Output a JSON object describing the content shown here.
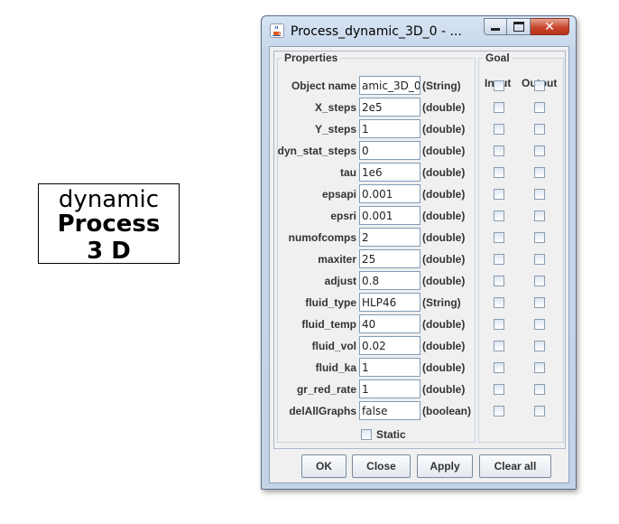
{
  "block": {
    "line1": "dynamic",
    "line2": "Process",
    "line3": "3 D"
  },
  "window": {
    "title": "Process_dynamic_3D_0 - ...",
    "icon": "java-cup-icon",
    "controls": {
      "minimize": "minimize-icon",
      "maximize": "maximize-icon",
      "close": "close-icon"
    }
  },
  "properties": {
    "legend": "Properties",
    "rows": [
      {
        "name": "Object name",
        "value": "amic_3D_0",
        "type": "(String)"
      },
      {
        "name": "X_steps",
        "value": "2e5",
        "type": "(double)"
      },
      {
        "name": "Y_steps",
        "value": "1",
        "type": "(double)"
      },
      {
        "name": "dyn_stat_steps",
        "value": "0",
        "type": "(double)"
      },
      {
        "name": "tau",
        "value": "1e6",
        "type": "(double)"
      },
      {
        "name": "epsapi",
        "value": "0.001",
        "type": "(double)"
      },
      {
        "name": "epsri",
        "value": "0.001",
        "type": "(double)"
      },
      {
        "name": "numofcomps",
        "value": "2",
        "type": "(double)"
      },
      {
        "name": "maxiter",
        "value": "25",
        "type": "(double)"
      },
      {
        "name": "adjust",
        "value": "0.8",
        "type": "(double)"
      },
      {
        "name": "fluid_type",
        "value": "HLP46",
        "type": "(String)"
      },
      {
        "name": "fluid_temp",
        "value": "40",
        "type": "(double)"
      },
      {
        "name": "fluid_vol",
        "value": "0.02",
        "type": "(double)"
      },
      {
        "name": "fluid_ka",
        "value": "1",
        "type": "(double)"
      },
      {
        "name": "gr_red_rate",
        "value": "1",
        "type": "(double)"
      },
      {
        "name": "delAllGraphs",
        "value": "false",
        "type": "(boolean)"
      }
    ],
    "static_label": "Static"
  },
  "goal": {
    "legend": "Goal",
    "input_header": "Input",
    "output_header": "Output"
  },
  "buttons": {
    "ok": "OK",
    "close": "Close",
    "apply": "Apply",
    "clear_all": "Clear all"
  }
}
